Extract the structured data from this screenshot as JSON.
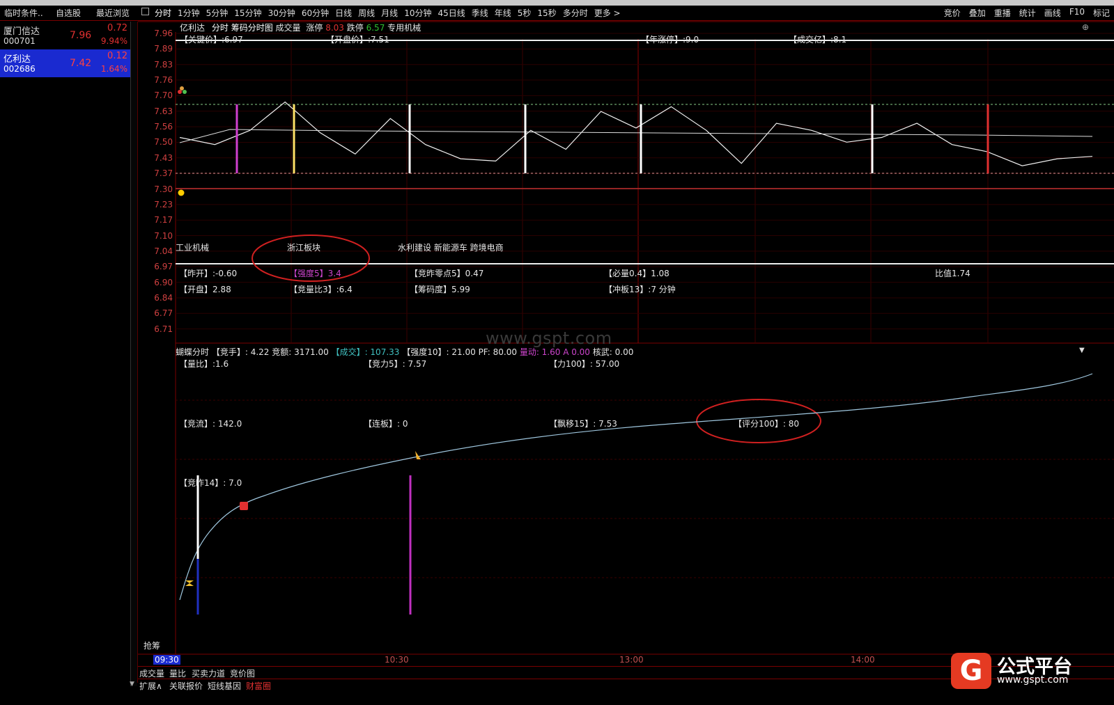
{
  "tabs": {
    "conditions": "临时条件..",
    "watchlist": "自选股",
    "recent": "最近浏览"
  },
  "periods": [
    "分时",
    "1分钟",
    "5分钟",
    "15分钟",
    "30分钟",
    "60分钟",
    "日线",
    "周线",
    "月线",
    "10分钟",
    "45日线",
    "季线",
    "年线",
    "5秒",
    "15秒",
    "多分时",
    "更多 >"
  ],
  "tools": [
    "竞价",
    "叠加",
    "重播",
    "统计",
    "画线",
    "F10",
    "标记"
  ],
  "stocks": [
    {
      "name": "厦门信达",
      "code": "000701",
      "price": "7.96",
      "change": "0.72",
      "pct": "9.94%"
    },
    {
      "name": "亿利达",
      "code": "002686",
      "price": "7.42",
      "change": "0.12",
      "pct": "1.64%"
    }
  ],
  "chart_header": {
    "name": "亿利达",
    "mode": "分时",
    "chip": "筹码分时图",
    "volume": "成交量",
    "limit_up_label": "涨停",
    "limit_up": "8.03",
    "limit_down_label": "跌停",
    "limit_down": "6.57",
    "sector": "专用机械"
  },
  "top_row": {
    "key_price": "【关键价】:6.97",
    "open_price": "【开盘价】:7.51",
    "year_up": "【年涨停】:9.0",
    "turnover": "【成交亿】:8.1"
  },
  "y_axis": [
    "7.96",
    "7.89",
    "7.83",
    "7.76",
    "7.70",
    "7.63",
    "7.56",
    "7.50",
    "7.43",
    "7.37",
    "7.30",
    "7.23",
    "7.17",
    "7.10",
    "7.04",
    "6.97",
    "6.90",
    "6.84",
    "6.77",
    "6.71"
  ],
  "sectors": {
    "s1": "工业机械",
    "s2": "浙江板块",
    "s3": "水利建设 新能源车 跨境电商"
  },
  "indicators1": {
    "zuokai": "【昨开】:-0.60",
    "qiangdu": "【强度5】3.4",
    "jingzuo": "【竞昨零点5】0.47",
    "bilang": "【必量0.4】1.08",
    "bizhi": "比值1.74"
  },
  "indicators2": {
    "kaipan": "【开盘】2.88",
    "jingliangbi": "【竞量比3】:6.4",
    "choumadu": "【筹码度】5.99",
    "chongban": "【冲板13】:7 分钟"
  },
  "watermark": "www.gspt.com",
  "lower_header": {
    "title": "蝴蝶分时",
    "jingshou": "【竞手】: 4.22",
    "jinge": "竞额: 3171.00",
    "chengjiao": "【成交】: 107.33",
    "qiangdu10": "【强度10】: 21.00",
    "pf": "PF: 80.00",
    "liangdong": "量动: 1.60 A 0.00",
    "hewu": "核武: 0.00"
  },
  "lower_labels": {
    "liangbi": "【量比】:1.6",
    "jingli": "【竞力5】: 7.57",
    "li100": "【力100】: 57.00",
    "jingliu": "【竞流】: 142.0",
    "lianban": "【连板】: 0",
    "piaoyi": "【飘移15】: 7.53",
    "pingfen": "【评分100】: 80",
    "jingzuo14": "【竞昨14】: 7.0"
  },
  "qiangchou": "抢筹",
  "time_axis": [
    "09:30",
    "10:30",
    "13:00",
    "14:00"
  ],
  "bottom_tabs1": [
    "成交量",
    "量比",
    "买卖力道",
    "竞价图"
  ],
  "bottom_tabs2": [
    "扩展∧",
    "关联报价",
    "短线基因",
    "财富圈"
  ],
  "logo": {
    "mark": "G",
    "name": "公式平台",
    "url": "www.gspt.com"
  },
  "colors": {
    "up": "#e03030",
    "grid": "#7a0000",
    "accent_magenta": "#cc33cc",
    "accent_yellow": "#ffe066",
    "selected": "#1a2ad0"
  },
  "chart_data": {
    "type": "line",
    "title": "亿利达 分时",
    "ylim": [
      6.71,
      7.96
    ],
    "x": [
      "09:30",
      "10:30",
      "13:00",
      "14:00"
    ],
    "series": [
      {
        "name": "分时",
        "values": [
          7.52,
          7.49,
          7.55,
          7.67,
          7.54,
          7.45,
          7.6,
          7.49,
          7.43,
          7.42,
          7.55,
          7.47,
          7.63,
          7.56,
          7.65,
          7.55,
          7.41,
          7.58,
          7.55,
          7.5,
          7.52,
          7.58,
          7.49,
          7.46,
          7.4,
          7.43,
          7.44
        ]
      }
    ]
  }
}
